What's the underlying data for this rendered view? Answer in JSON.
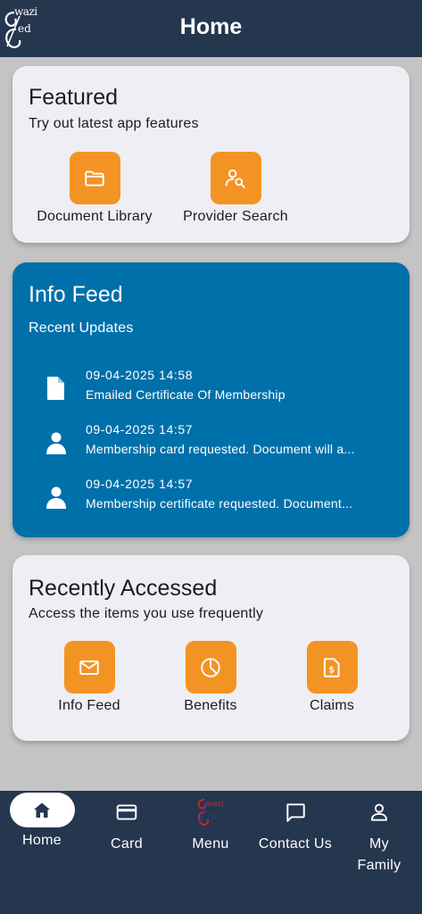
{
  "header": {
    "title": "Home",
    "logo_text_top": "wazi",
    "logo_text_bottom": "ed"
  },
  "featured": {
    "title": "Featured",
    "subtitle": "Try out latest app features",
    "tiles": [
      {
        "label": "Document Library",
        "icon": "folder-icon"
      },
      {
        "label": "Provider Search",
        "icon": "user-search-icon"
      }
    ]
  },
  "info_feed": {
    "title": "Info Feed",
    "subtitle": "Recent Updates",
    "items": [
      {
        "date": "09-04-2025 14:58",
        "text": "Emailed Certificate Of Membership",
        "icon": "document-icon"
      },
      {
        "date": "09-04-2025 14:57",
        "text": "Membership card requested. Document will a...",
        "icon": "person-icon"
      },
      {
        "date": "09-04-2025 14:57",
        "text": "Membership certificate requested. Document...",
        "icon": "person-icon"
      }
    ]
  },
  "recent": {
    "title": "Recently Accessed",
    "subtitle": "Access the items you use frequently",
    "tiles": [
      {
        "label": "Info Feed",
        "icon": "mail-icon"
      },
      {
        "label": "Benefits",
        "icon": "pie-chart-icon"
      },
      {
        "label": "Claims",
        "icon": "invoice-icon"
      }
    ]
  },
  "nav": {
    "items": [
      {
        "label": "Home",
        "icon": "home-icon",
        "active": true
      },
      {
        "label": "Card",
        "icon": "card-icon"
      },
      {
        "label": "Menu",
        "icon": "logo-icon"
      },
      {
        "label": "Contact Us",
        "icon": "chat-icon"
      },
      {
        "label": "My Family",
        "icon": "person-outline-icon"
      }
    ]
  },
  "colors": {
    "header": "#25364f",
    "accent": "#f39324",
    "info_feed_bg": "#0070aa",
    "card_bg": "#eeeef4",
    "page_bg": "#c4c4c4"
  }
}
